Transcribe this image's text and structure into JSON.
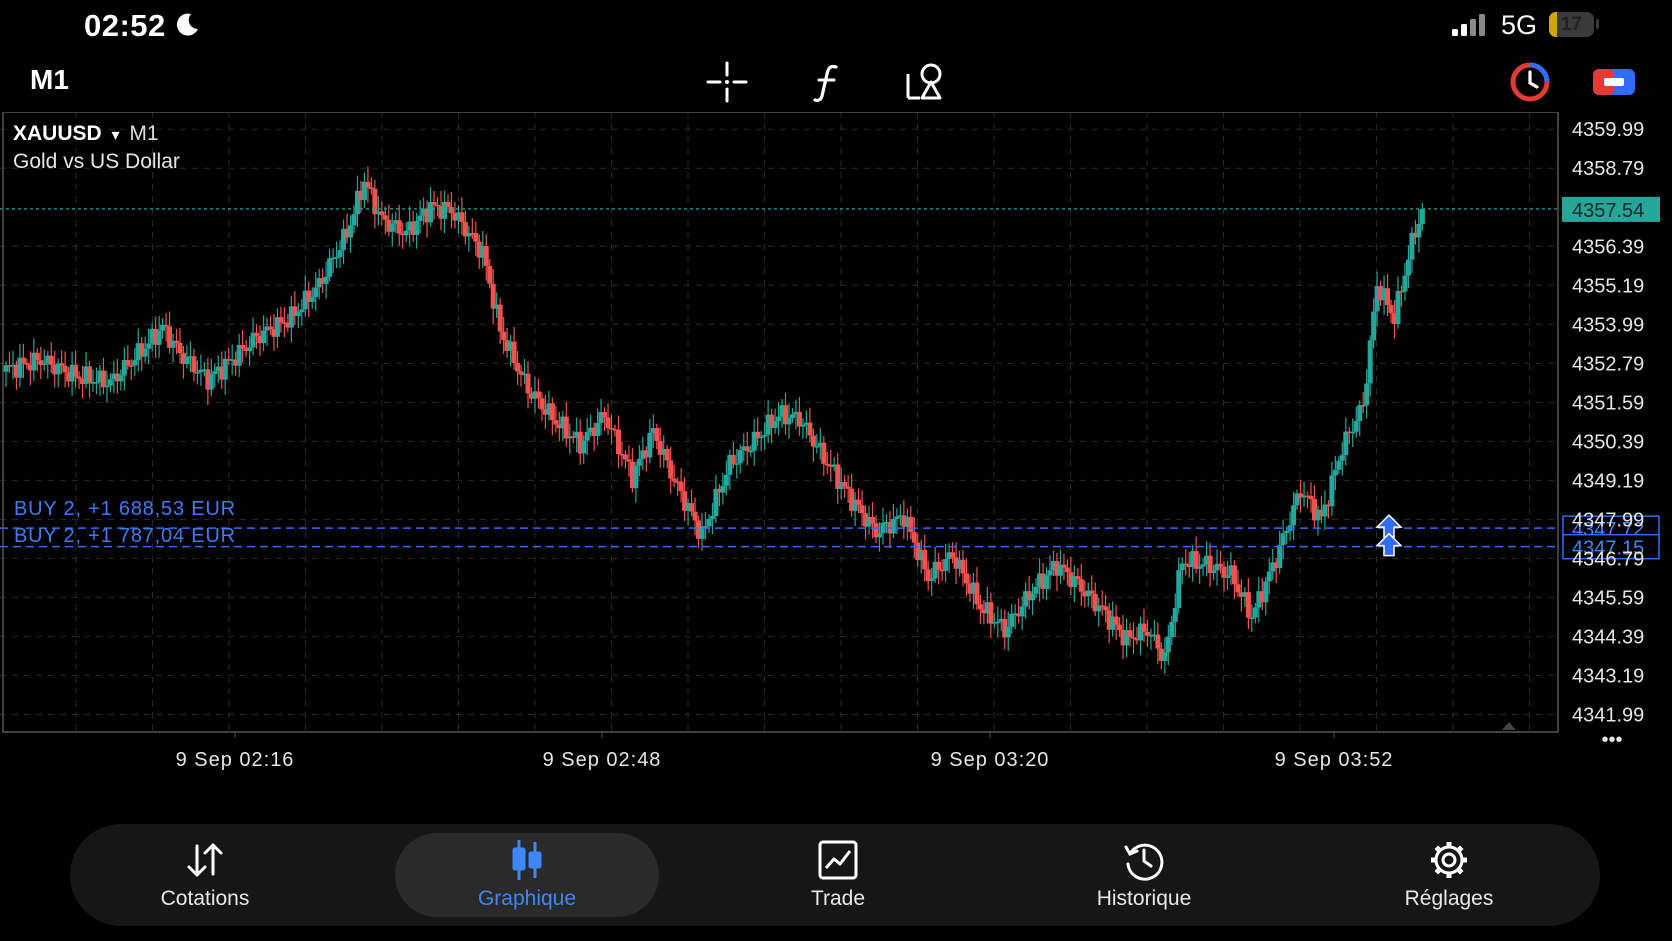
{
  "status": {
    "time": "02:52",
    "network": "5G",
    "battery": "17",
    "battery_level": 0.17
  },
  "toolbar": {
    "timeframe": "M1",
    "icons": [
      "crosshair-icon",
      "indicators-icon",
      "objects-icon",
      "one-click-trading-icon",
      "chart-mode-icon"
    ]
  },
  "chart": {
    "symbol": "XAUUSD",
    "symbol_arrow": "▾",
    "timeframe": "M1",
    "description": "Gold vs US Dollar",
    "current_price": "4357.54",
    "positions": [
      {
        "label": "BUY 2, +1 688,53 EUR",
        "price": "4347.72"
      },
      {
        "label": "BUY 2, +1 787,04 EUR",
        "price": "4347.15"
      }
    ],
    "colors": {
      "bull": "#26a69a",
      "bear": "#ef5350",
      "position": "#2f6df6",
      "bid_line": "#26a69a"
    },
    "more": "•••"
  },
  "chart_data": {
    "type": "candlestick",
    "y_ticks": [
      "4359.99",
      "4358.79",
      "4356.39",
      "4355.19",
      "4353.99",
      "4352.79",
      "4351.59",
      "4350.39",
      "4349.19",
      "4347.99",
      "4346.79",
      "4345.59",
      "4344.39",
      "4343.19",
      "4341.99"
    ],
    "x_ticks": [
      "9 Sep 02:16",
      "9 Sep 02:48",
      "9 Sep 03:20",
      "9 Sep 03:52"
    ],
    "ylim": [
      4341.45,
      4360.52
    ],
    "grid": true,
    "close_anchors": [
      [
        0,
        4352.6
      ],
      [
        10,
        4352.9
      ],
      [
        20,
        4352.4
      ],
      [
        30,
        4352.2
      ],
      [
        40,
        4353.3
      ],
      [
        45,
        4353.9
      ],
      [
        50,
        4353.1
      ],
      [
        58,
        4352.3
      ],
      [
        65,
        4352.9
      ],
      [
        72,
        4353.6
      ],
      [
        82,
        4354.2
      ],
      [
        90,
        4355.2
      ],
      [
        98,
        4356.8
      ],
      [
        103,
        4358.4
      ],
      [
        108,
        4357.2
      ],
      [
        115,
        4356.8
      ],
      [
        122,
        4357.6
      ],
      [
        128,
        4357.5
      ],
      [
        137,
        4356.2
      ],
      [
        142,
        4353.8
      ],
      [
        150,
        4352.0
      ],
      [
        158,
        4351.0
      ],
      [
        165,
        4350.3
      ],
      [
        172,
        4351.2
      ],
      [
        180,
        4349.3
      ],
      [
        186,
        4350.7
      ],
      [
        192,
        4349.2
      ],
      [
        200,
        4347.5
      ],
      [
        208,
        4349.7
      ],
      [
        215,
        4350.4
      ],
      [
        222,
        4351.2
      ],
      [
        228,
        4351.1
      ],
      [
        235,
        4349.9
      ],
      [
        243,
        4348.6
      ],
      [
        250,
        4347.6
      ],
      [
        258,
        4348.1
      ],
      [
        265,
        4346.2
      ],
      [
        272,
        4346.9
      ],
      [
        280,
        4345.3
      ],
      [
        287,
        4344.6
      ],
      [
        295,
        4345.8
      ],
      [
        302,
        4346.6
      ],
      [
        308,
        4346.0
      ],
      [
        315,
        4345.2
      ],
      [
        322,
        4344.3
      ],
      [
        328,
        4344.6
      ],
      [
        333,
        4343.7
      ],
      [
        338,
        4346.7
      ],
      [
        345,
        4346.6
      ],
      [
        352,
        4346.3
      ],
      [
        358,
        4345.0
      ],
      [
        365,
        4346.8
      ],
      [
        372,
        4348.9
      ],
      [
        378,
        4348.0
      ],
      [
        384,
        4350.2
      ],
      [
        390,
        4351.5
      ],
      [
        394,
        4355.2
      ],
      [
        399,
        4354.2
      ],
      [
        404,
        4356.5
      ],
      [
        407,
        4357.54
      ]
    ]
  },
  "nav": {
    "items": [
      {
        "label": "Cotations",
        "icon": "quotes-arrows-icon"
      },
      {
        "label": "Graphique",
        "icon": "candles-icon",
        "active": true
      },
      {
        "label": "Trade",
        "icon": "trade-chart-icon"
      },
      {
        "label": "Historique",
        "icon": "history-clock-icon"
      },
      {
        "label": "Réglages",
        "icon": "settings-gear-icon"
      }
    ]
  }
}
